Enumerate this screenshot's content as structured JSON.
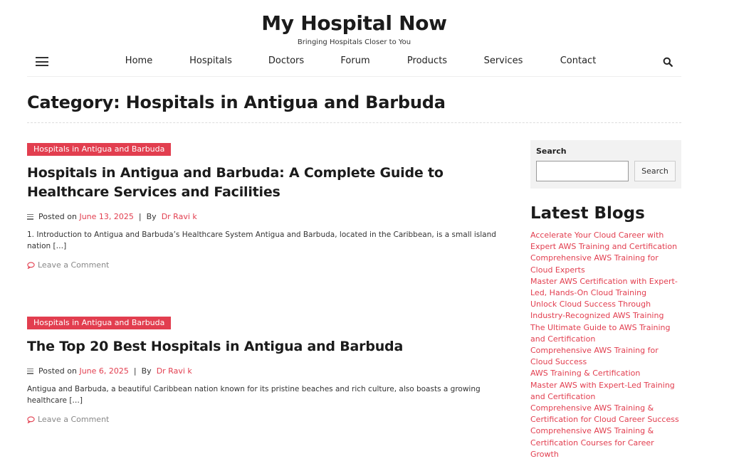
{
  "site": {
    "title": "My Hospital Now",
    "tagline": "Bringing Hospitals Closer to You"
  },
  "nav": {
    "items": [
      {
        "label": "Home"
      },
      {
        "label": "Hospitals"
      },
      {
        "label": "Doctors"
      },
      {
        "label": "Forum"
      },
      {
        "label": "Products"
      },
      {
        "label": "Services"
      },
      {
        "label": "Contact"
      }
    ]
  },
  "page": {
    "category_title": "Category: Hospitals in Antigua and Barbuda"
  },
  "posts": [
    {
      "category": "Hospitals in Antigua and Barbuda",
      "title": "Hospitals in Antigua and Barbuda: A Complete Guide to Healthcare Services and Facilities",
      "posted_on": "Posted on",
      "date": "June 13, 2025",
      "sep": "|",
      "by": "By",
      "author": "Dr Ravi k",
      "excerpt": "1. Introduction to Antigua and Barbuda’s Healthcare System Antigua and Barbuda, located in the Caribbean, is a small island nation […]",
      "comment": "Leave a Comment"
    },
    {
      "category": "Hospitals in Antigua and Barbuda",
      "title": "The Top 20 Best Hospitals in Antigua and Barbuda",
      "posted_on": "Posted on",
      "date": "June 6, 2025",
      "sep": "|",
      "by": "By",
      "author": "Dr Ravi k",
      "excerpt": "Antigua and Barbuda, a beautiful Caribbean nation known for its pristine beaches and rich culture, also boasts a growing healthcare […]",
      "comment": "Leave a Comment"
    }
  ],
  "sidebar": {
    "search_label": "Search",
    "search_button": "Search",
    "search_value": "",
    "latest_title": "Latest Blogs",
    "latest": [
      "Accelerate Your Cloud Career with Expert AWS Training and Certification",
      "Comprehensive AWS Training for Cloud Experts",
      "Master AWS Certification with Expert-Led, Hands-On Cloud Training",
      "Unlock Cloud Success Through Industry-Recognized AWS Training",
      "The Ultimate Guide to AWS Training and Certification",
      "Comprehensive AWS Training for Cloud Success",
      "AWS Training & Certification",
      "Master AWS with Expert-Led Training and Certification",
      "Comprehensive AWS Training & Certification for Cloud Career Success",
      "Comprehensive AWS Training & Certification Courses for Career Growth"
    ]
  },
  "colors": {
    "accent": "#e23e4f",
    "text": "#1b1b1b"
  },
  "icons": {
    "menu": "hamburger-menu-icon",
    "search": "search-icon",
    "meta": "lines-icon",
    "comment": "comment-bubble-icon"
  }
}
